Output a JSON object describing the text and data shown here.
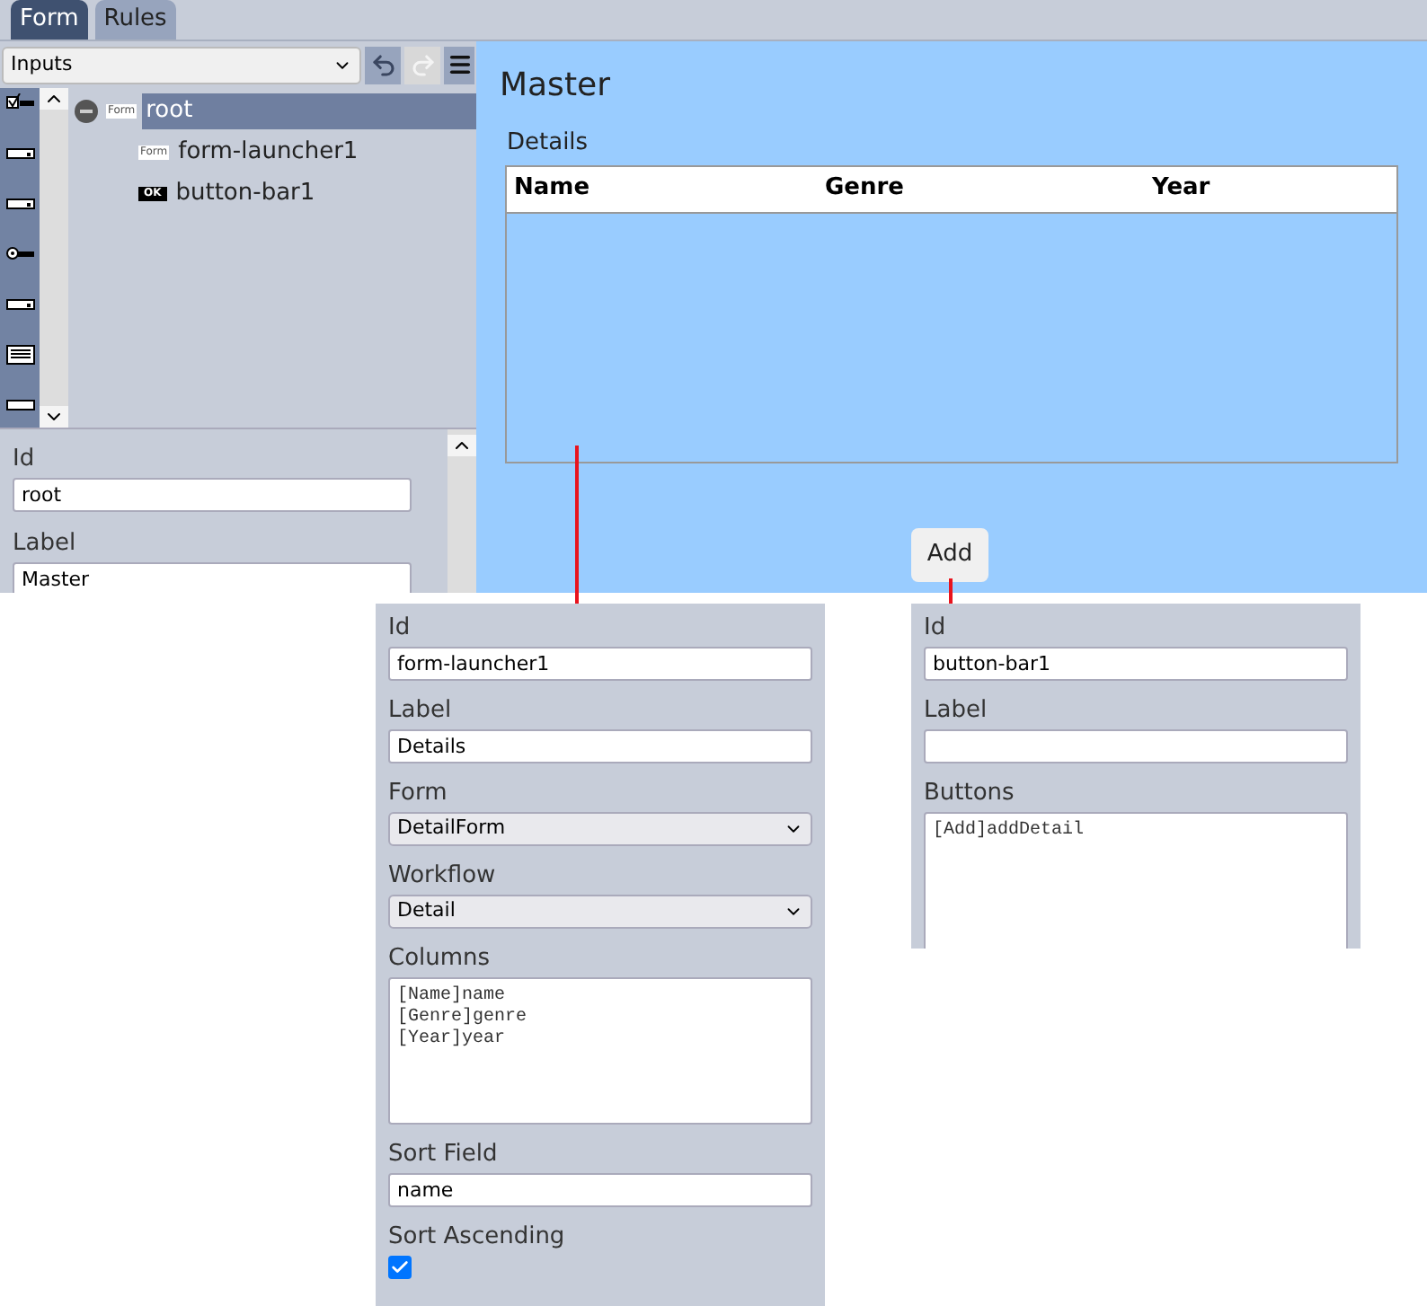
{
  "tabs": [
    {
      "label": "Form",
      "selected": true
    },
    {
      "label": "Rules",
      "selected": false
    }
  ],
  "palette": {
    "value": "Inputs"
  },
  "tree": [
    {
      "label": "root",
      "badge": "Form",
      "selected": true,
      "expanded": true,
      "children": [
        {
          "label": "form-launcher1",
          "badge": "Form",
          "selected": false
        },
        {
          "label": "button-bar1",
          "badge": "OK",
          "selected": false
        }
      ]
    }
  ],
  "root_properties": [
    {
      "kind": "text",
      "label": "Id",
      "value": "root"
    },
    {
      "kind": "text",
      "label": "Label",
      "value": "Master"
    }
  ],
  "preview": {
    "title": "Master",
    "launcher_label": "Details",
    "columns": [
      "Name",
      "Genre",
      "Year"
    ],
    "button": "Add"
  },
  "launcher_properties": [
    {
      "kind": "text",
      "label": "Id",
      "value": "form-launcher1"
    },
    {
      "kind": "text",
      "label": "Label",
      "value": "Details"
    },
    {
      "kind": "select",
      "label": "Form",
      "value": "DetailForm"
    },
    {
      "kind": "select",
      "label": "Workflow",
      "value": "Detail"
    },
    {
      "kind": "textarea",
      "label": "Columns",
      "value": "[Name]name\n[Genre]genre\n[Year]year"
    },
    {
      "kind": "text",
      "label": "Sort Field",
      "value": "name"
    },
    {
      "kind": "checkbox",
      "label": "Sort Ascending",
      "checked": true
    }
  ],
  "button_bar_properties": [
    {
      "kind": "text",
      "label": "Id",
      "value": "button-bar1"
    },
    {
      "kind": "text",
      "label": "Label"
    },
    {
      "kind": "textarea",
      "label": "Buttons",
      "value": "[Add]addDetail"
    }
  ]
}
